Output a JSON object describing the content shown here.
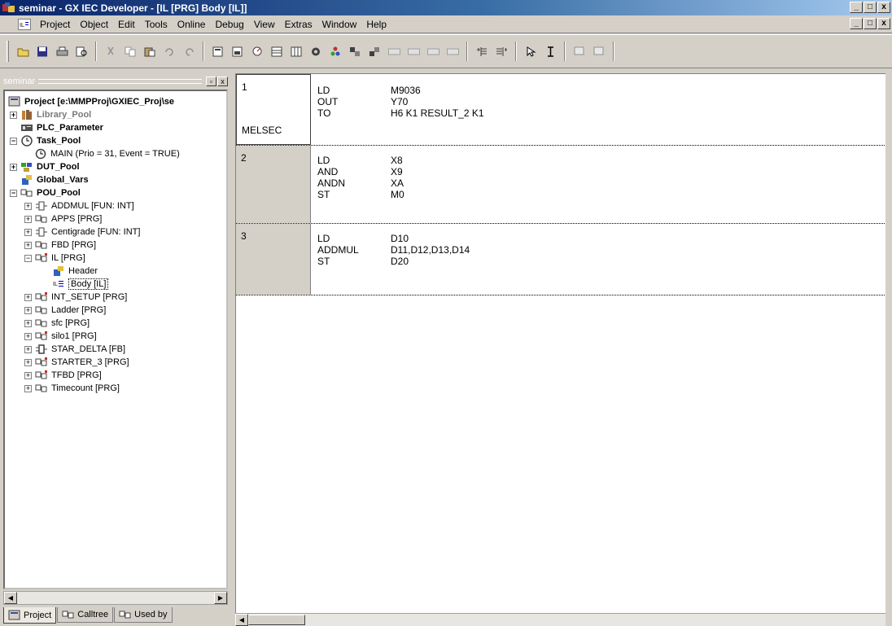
{
  "window": {
    "title": "seminar - GX IEC Developer - [IL [PRG] Body [IL]]",
    "minimize": "_",
    "maximize": "□",
    "close": "x"
  },
  "menu": {
    "items": [
      "Project",
      "Object",
      "Edit",
      "Tools",
      "Online",
      "Debug",
      "View",
      "Extras",
      "Window",
      "Help"
    ]
  },
  "toolbar": {
    "buttons": [
      "new-icon",
      "save-icon",
      "print-icon",
      "print-preview-icon",
      "cut-icon",
      "copy-icon",
      "paste-icon",
      "undo-icon",
      "redo-icon",
      "open-header-icon",
      "open-body-icon",
      "monitor-icon",
      "var-list-icon",
      "table-icon",
      "compile-icon",
      "build-icon",
      "transfer-icon",
      "transfer2-icon",
      "f1-icon",
      "f2-icon",
      "f3-icon",
      "f4-icon",
      "insert-line-icon",
      "delete-line-icon",
      "select-icon",
      "text-cursor-icon",
      "online-icon",
      "offline-icon"
    ]
  },
  "project_pane": {
    "caption": "seminar",
    "tree": [
      {
        "label": "Project [e:\\MMPProj\\GXIEC_Proj\\se",
        "bold": true
      },
      {
        "label": "Library_Pool",
        "bold": true,
        "gray": true
      },
      {
        "label": "PLC_Parameter",
        "bold": true
      },
      {
        "label": "Task_Pool",
        "bold": true
      },
      {
        "label": "MAIN (Prio = 31, Event = TRUE)"
      },
      {
        "label": "DUT_Pool",
        "bold": true
      },
      {
        "label": "Global_Vars",
        "bold": true
      },
      {
        "label": "POU_Pool",
        "bold": true
      },
      {
        "label": "ADDMUL [FUN: INT]"
      },
      {
        "label": "APPS [PRG]"
      },
      {
        "label": "Centigrade [FUN: INT]"
      },
      {
        "label": "FBD [PRG]"
      },
      {
        "label": "IL [PRG]"
      },
      {
        "label": "Header"
      },
      {
        "label": "Body [IL]"
      },
      {
        "label": "INT_SETUP [PRG]"
      },
      {
        "label": "Ladder [PRG]"
      },
      {
        "label": "sfc [PRG]"
      },
      {
        "label": "silo1 [PRG]"
      },
      {
        "label": "STAR_DELTA [FB]"
      },
      {
        "label": "STARTER_3 [PRG]"
      },
      {
        "label": "TFBD [PRG]"
      },
      {
        "label": "Timecount [PRG]"
      }
    ],
    "tabs": [
      "Project",
      "Calltree",
      "Used by"
    ]
  },
  "editor": {
    "networks": [
      {
        "number": "1",
        "tag": "MELSEC",
        "lines": [
          {
            "op": "LD",
            "arg": "M9036"
          },
          {
            "op": "OUT",
            "arg": "Y70"
          },
          {
            "op": "TO",
            "arg": "H6  K1 RESULT_2 K1"
          }
        ]
      },
      {
        "number": "2",
        "tag": "",
        "lines": [
          {
            "op": "LD",
            "arg": "X8"
          },
          {
            "op": "AND",
            "arg": "X9"
          },
          {
            "op": "ANDN",
            "arg": "XA"
          },
          {
            "op": "ST",
            "arg": "M0"
          }
        ]
      },
      {
        "number": "3",
        "tag": "",
        "lines": [
          {
            "op": "LD",
            "arg": "D10"
          },
          {
            "op": "ADDMUL",
            "arg": "D11,D12,D13,D14"
          },
          {
            "op": "ST",
            "arg": "D20"
          }
        ]
      }
    ]
  }
}
